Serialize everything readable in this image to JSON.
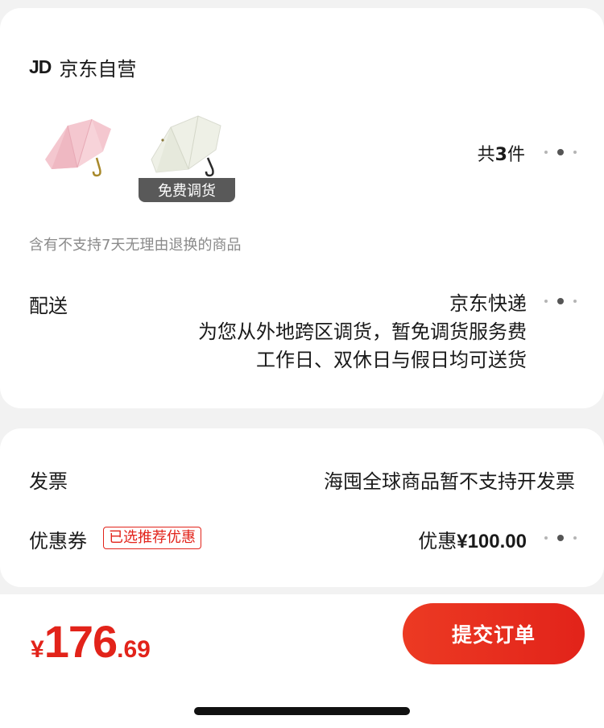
{
  "store": {
    "logo": "JD",
    "name": "京东自营",
    "transfer_badge": "免费调货",
    "item_count_prefix": "共",
    "item_count": "3",
    "item_count_suffix": "件",
    "notice": "含有不支持7天无理由退换的商品"
  },
  "delivery": {
    "label": "配送",
    "carrier": "京东快递",
    "line2": "为您从外地跨区调货，暂免调货服务费",
    "line3": "工作日、双休日与假日均可送货"
  },
  "invoice": {
    "label": "发票",
    "value": "海囤全球商品暂不支持开发票"
  },
  "coupon": {
    "label": "优惠券",
    "tag": "已选推荐优惠",
    "value_prefix": "优惠",
    "value_amount": "¥100.00"
  },
  "total": {
    "currency": "¥",
    "integer": "176",
    "decimal": ".69"
  },
  "submit_label": "提交订单",
  "colors": {
    "accent": "#e2231a",
    "umbrella_pink": "#f4c7cf",
    "umbrella_cream": "#eef0e6"
  },
  "icons": {
    "more": "more-dots-icon"
  }
}
